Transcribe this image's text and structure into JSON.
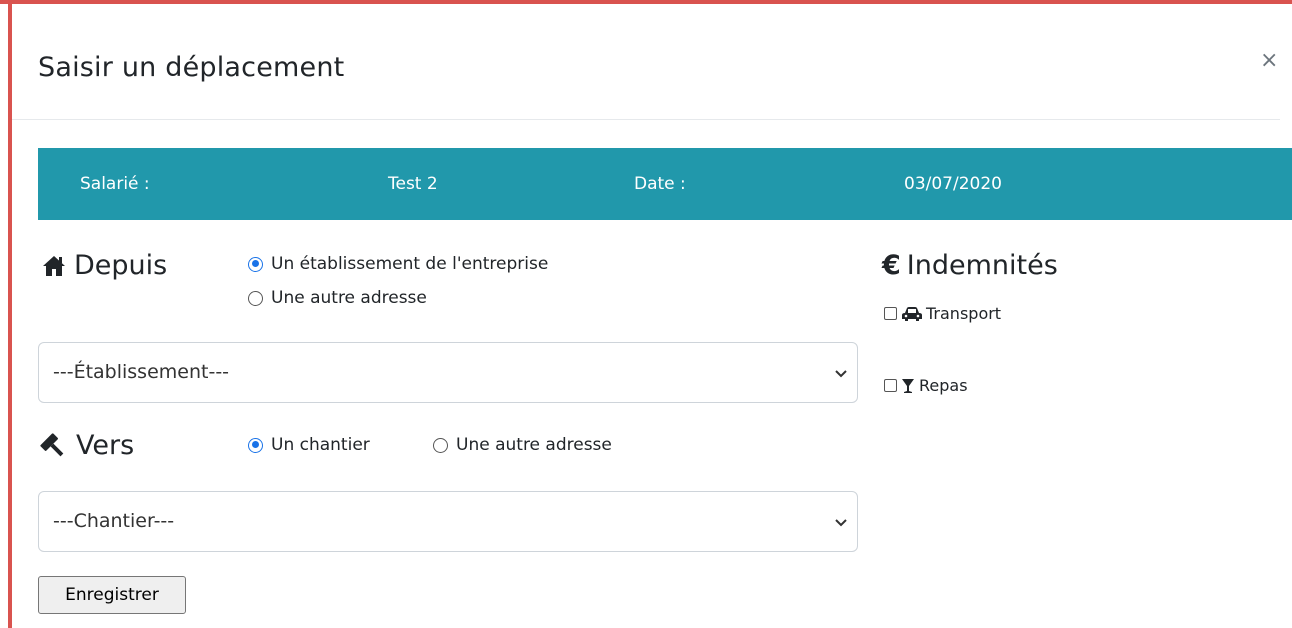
{
  "modal": {
    "title": "Saisir un déplacement",
    "close": "×"
  },
  "info_bar": {
    "employee_label": "Salarié :",
    "employee_value": "Test 2",
    "date_label": "Date :",
    "date_value": "03/07/2020",
    "background_color": "#2198ab"
  },
  "depuis": {
    "title": "Depuis",
    "icon": "home-icon",
    "options": [
      {
        "label": "Un établissement de l'entreprise",
        "checked": true
      },
      {
        "label": "Une autre adresse",
        "checked": false
      }
    ],
    "select_value": "---Établissement---"
  },
  "vers": {
    "title": "Vers",
    "icon": "gavel-icon",
    "options": [
      {
        "label": "Un chantier",
        "checked": true
      },
      {
        "label": "Une autre adresse",
        "checked": false
      }
    ],
    "select_value": "---Chantier---"
  },
  "indemnites": {
    "title": "Indemnités",
    "icon": "euro-icon",
    "symbol": "€",
    "items": [
      {
        "label": "Transport",
        "icon": "car-icon",
        "checked": false
      },
      {
        "label": "Repas",
        "icon": "cocktail-icon",
        "checked": false
      }
    ]
  },
  "submit_label": "Enregistrer",
  "colors": {
    "accent": "#2198ab",
    "frame": "#d9534f",
    "radio_checked": "#1a73e8"
  }
}
